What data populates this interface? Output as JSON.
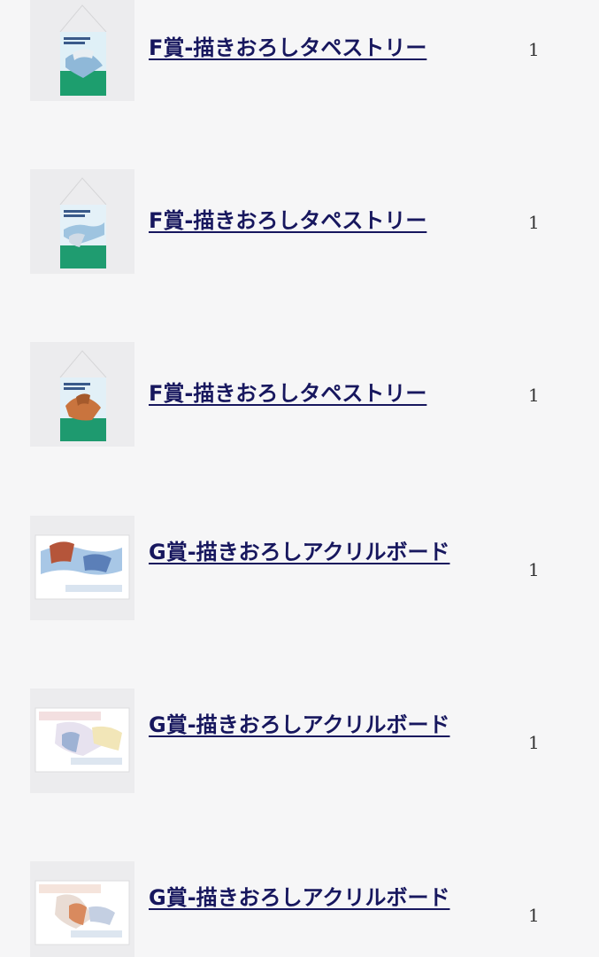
{
  "items": [
    {
      "title": "F賞-描きおろしタペストリー",
      "qty": "1",
      "kind": "tapestry"
    },
    {
      "title": "F賞-描きおろしタペストリー",
      "qty": "1",
      "kind": "tapestry"
    },
    {
      "title": "F賞-描きおろしタペストリー",
      "qty": "1",
      "kind": "tapestry"
    },
    {
      "title": "G賞-描きおろしアクリルボード",
      "qty": "1",
      "kind": "acrylic-board"
    },
    {
      "title": "G賞-描きおろしアクリルボード",
      "qty": "1",
      "kind": "acrylic-board"
    },
    {
      "title": "G賞-描きおろしアクリルボード",
      "qty": "1",
      "kind": "acrylic-board"
    }
  ],
  "colors": {
    "background": "#f6f6f7",
    "link": "#17175e",
    "quantity": "#333333"
  }
}
